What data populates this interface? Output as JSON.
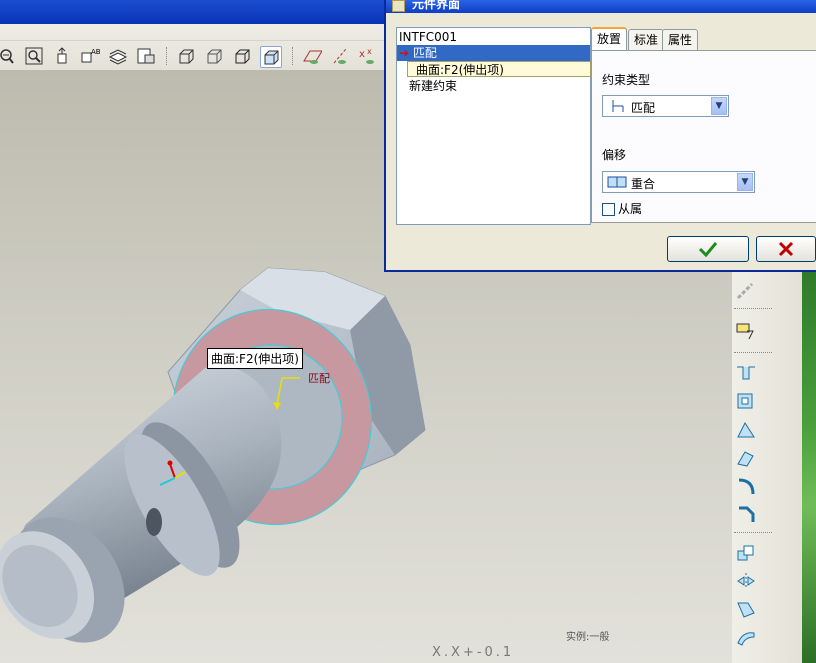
{
  "dialog": {
    "title": "元件界面",
    "tree": {
      "root": "INTFC001",
      "selected_constraint": "匹配",
      "selected_reference": "曲面:F2(伸出项)",
      "new_constraint": "新建约束"
    },
    "tabs": [
      {
        "label": "放置",
        "active": true
      },
      {
        "label": "标准",
        "active": false
      },
      {
        "label": "属性",
        "active": false
      }
    ],
    "constraint_type": {
      "label": "约束类型",
      "value": "匹配"
    },
    "offset": {
      "label": "偏移",
      "value": "重合"
    },
    "dependent": {
      "label": "从属",
      "checked": false
    },
    "ok_icon": "check-icon",
    "cancel_icon": "close-icon"
  },
  "viewport": {
    "surface_tooltip": "曲面:F2(伸出项)",
    "constraint_tag": "匹配",
    "status_text": "实例:一般",
    "coord_text": "X.X+-0.1"
  },
  "colors": {
    "titlebar_blue": "#0d3fc4",
    "selection_blue": "#316ac5",
    "ok_green": "#1e8c1e",
    "cancel_red": "#c00000",
    "mating_surface": "#c8969e",
    "highlight_cyan": "#2fd3e0"
  },
  "top_toolbar_icons": [
    "zoom-out-icon",
    "refit-icon",
    "spin-center-icon",
    "named-views-icon",
    "layers-icon",
    "view-manager-icon",
    "wireframe-icon",
    "hidden-line-icon",
    "no-hidden-icon",
    "shading-icon",
    "datum-planes-icon",
    "datum-axes-icon",
    "datum-points-icon"
  ],
  "right_toolbar_icons": [
    "datum-chain-icon",
    "sketch-icon",
    "extrude-cut-icon",
    "hole-icon",
    "draft-icon",
    "rib-icon",
    "round-icon",
    "chamfer-icon",
    "copy-icon",
    "mirror-icon",
    "merge-icon",
    "surface-icon"
  ]
}
